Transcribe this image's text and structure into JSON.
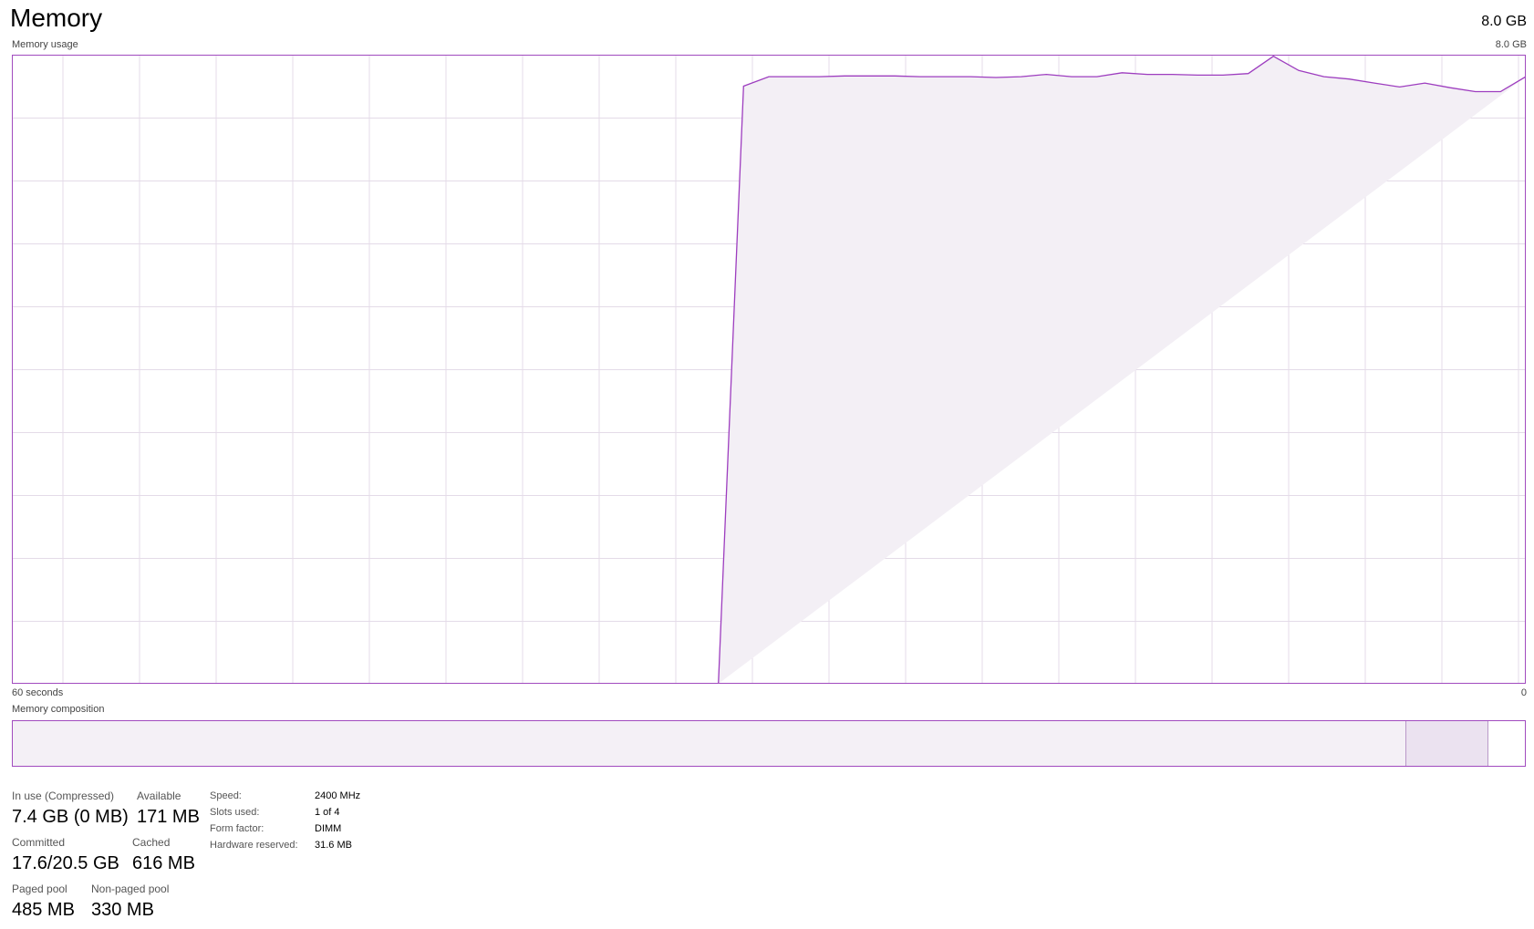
{
  "header": {
    "title": "Memory",
    "total": "8.0 GB"
  },
  "graph": {
    "label": "Memory usage",
    "max_label": "8.0 GB",
    "time_left_label": "60 seconds",
    "time_right_label": "0"
  },
  "composition": {
    "label": "Memory composition",
    "in_use_fraction": 0.921,
    "modified_fraction": 0.055,
    "free_fraction": 0.019
  },
  "stats": {
    "in_use_label": "In use (Compressed)",
    "in_use_value": "7.4 GB (0 MB)",
    "available_label": "Available",
    "available_value": "171 MB",
    "committed_label": "Committed",
    "committed_value": "17.6/20.5 GB",
    "cached_label": "Cached",
    "cached_value": "616 MB",
    "paged_pool_label": "Paged pool",
    "paged_pool_value": "485 MB",
    "non_paged_pool_label": "Non-paged pool",
    "non_paged_pool_value": "330 MB"
  },
  "specs": {
    "speed_label": "Speed:",
    "speed_value": "2400 MHz",
    "slots_label": "Slots used:",
    "slots_value": "1 of 4",
    "form_factor_label": "Form factor:",
    "form_factor_value": "DIMM",
    "hw_reserved_label": "Hardware reserved:",
    "hw_reserved_value": "31.6 MB"
  },
  "colors": {
    "line": "#9d3dbf",
    "fill": "#f3eff5",
    "grid": "#e4dbe8",
    "border": "#a14bbf"
  },
  "chart_data": {
    "type": "area",
    "xlabel": "",
    "ylabel": "",
    "xlim": [
      60,
      0
    ],
    "ylim": [
      0,
      8.0
    ],
    "grid": true,
    "x": [
      60,
      59,
      58,
      57,
      56,
      55,
      54,
      53,
      52,
      51,
      50,
      49,
      48,
      47,
      46,
      45,
      44,
      43,
      42,
      41,
      40,
      39,
      38,
      37,
      36,
      35,
      34,
      33,
      32,
      31,
      30,
      29,
      28,
      27,
      26,
      25,
      24,
      23,
      22,
      21,
      20,
      19,
      18,
      17,
      16,
      15,
      14,
      13,
      12,
      11,
      10,
      9,
      8,
      7,
      6,
      5,
      4,
      3,
      2,
      1,
      0
    ],
    "values": [
      0,
      0,
      0,
      0,
      0,
      0,
      0,
      0,
      0,
      0,
      0,
      0,
      0,
      0,
      0,
      0,
      0,
      0,
      0,
      0,
      0,
      0,
      0,
      0,
      0,
      0,
      0,
      0,
      0,
      7.6,
      7.72,
      7.72,
      7.72,
      7.73,
      7.73,
      7.73,
      7.72,
      7.72,
      7.72,
      7.71,
      7.72,
      7.75,
      7.72,
      7.72,
      7.77,
      7.75,
      7.75,
      7.74,
      7.74,
      7.76,
      7.98,
      7.8,
      7.72,
      7.69,
      7.64,
      7.59,
      7.64,
      7.58,
      7.53,
      7.53,
      7.72,
      7.83
    ]
  }
}
